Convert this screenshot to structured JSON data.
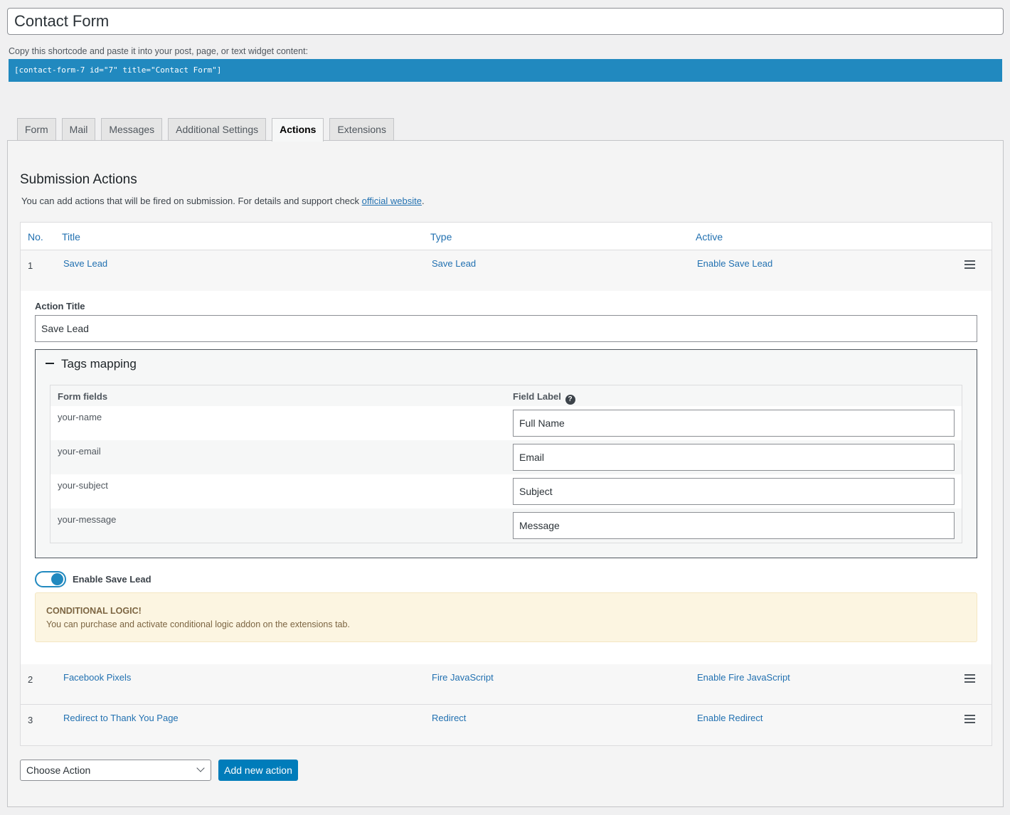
{
  "form_title": "Contact Form",
  "shortcode": {
    "hint": "Copy this shortcode and paste it into your post, page, or text widget content:",
    "code": "[contact-form-7 id=\"7\" title=\"Contact Form\"]"
  },
  "tabs": [
    {
      "label": "Form",
      "active": false
    },
    {
      "label": "Mail",
      "active": false
    },
    {
      "label": "Messages",
      "active": false
    },
    {
      "label": "Additional Settings",
      "active": false
    },
    {
      "label": "Actions",
      "active": true
    },
    {
      "label": "Extensions",
      "active": false
    }
  ],
  "section": {
    "title": "Submission Actions",
    "desc_prefix": "You can add actions that will be fired on submission. For details and support check ",
    "desc_link": "official website",
    "desc_suffix": "."
  },
  "table": {
    "headers": {
      "no": "No.",
      "title": "Title",
      "type": "Type",
      "active": "Active"
    },
    "rows": [
      {
        "no": "1",
        "title": "Save Lead",
        "type": "Save Lead",
        "active": "Enable Save Lead",
        "menu_icon": "hamburger-icon"
      },
      {
        "no": "2",
        "title": "Facebook Pixels",
        "type": "Fire JavaScript",
        "active": "Enable Fire JavaScript",
        "menu_icon": "hamburger-icon"
      },
      {
        "no": "3",
        "title": "Redirect to Thank You Page",
        "type": "Redirect",
        "active": "Enable Redirect",
        "menu_icon": "hamburger-icon"
      }
    ]
  },
  "editor": {
    "action_title_label": "Action Title",
    "action_title_value": "Save Lead",
    "tags_mapping": {
      "heading": "Tags mapping",
      "col_form_fields": "Form fields",
      "col_field_label": "Field Label",
      "help_icon": "?",
      "rows": [
        {
          "field": "your-name",
          "label": "Full Name"
        },
        {
          "field": "your-email",
          "label": "Email"
        },
        {
          "field": "your-subject",
          "label": "Subject"
        },
        {
          "field": "your-message",
          "label": "Message"
        }
      ]
    },
    "toggle_label": "Enable Save Lead",
    "toggle_on": true,
    "notice": {
      "title": "CONDITIONAL LOGIC!",
      "text": "You can purchase and activate conditional logic addon on the extensions tab."
    }
  },
  "bottom": {
    "select_value": "Choose Action",
    "add_button": "Add new action"
  },
  "colors": {
    "accent": "#2189bf",
    "button": "#007cba",
    "link": "#2271b1",
    "notice_bg": "#fcf5e1"
  }
}
